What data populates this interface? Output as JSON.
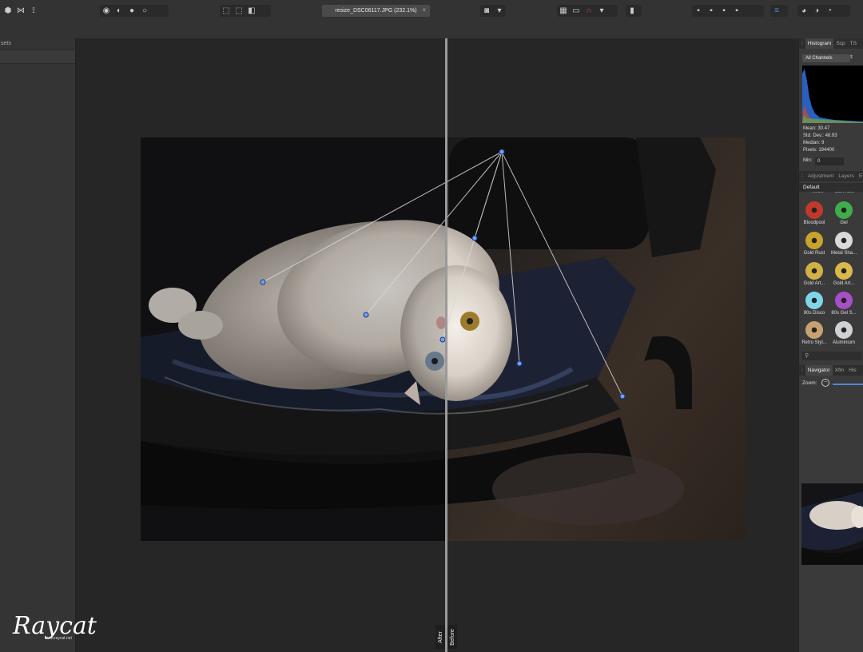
{
  "document": {
    "tab_title": "resize_DSC06117.JPG (232.1%)",
    "close_glyph": "×"
  },
  "left_panel": {
    "tab_label": "sets"
  },
  "compare": {
    "after_label": "After",
    "before_label": "Before"
  },
  "right_panel": {
    "top_tabs": [
      "Histogram",
      "Scp",
      "TS"
    ],
    "channel_select": "All Channels",
    "stats": {
      "mean": "Mean: 30.47",
      "std_dev": "Std. Dev.: 48.93",
      "median": "Median: 9",
      "pixels": "Pixels: 194400"
    },
    "min_label": "Min:",
    "min_value": "0",
    "mid_tabs": [
      "Adjustment",
      "Layers",
      "Ef"
    ],
    "preset_category": "Default",
    "cutoff_row": [
      "Neon",
      "Dark Glo"
    ],
    "presets": [
      {
        "label": "Bloodpool",
        "color": "#c0392b"
      },
      {
        "label": "Gel",
        "color": "#3fae49"
      },
      {
        "label": "Gold Rust",
        "color": "#c9a42c"
      },
      {
        "label": "Metal Sha...",
        "color": "#d9d9d9"
      },
      {
        "label": "Gold Art...",
        "color": "#d1b046"
      },
      {
        "label": "Gold Art...",
        "color": "#dbb84a"
      },
      {
        "label": "80s Disco",
        "color": "#7fd6e8"
      },
      {
        "label": "80s Gel S...",
        "color": "#a64fc6"
      },
      {
        "label": "Retro Styl...",
        "color": "#c7a271"
      },
      {
        "label": "Aluminium",
        "color": "#cfd2d4"
      }
    ],
    "bottom_tabs": [
      "Navigator",
      "Xfm",
      "His"
    ],
    "zoom_label": "Zoom:"
  },
  "watermark": {
    "text": "Raycat",
    "sub": "www.raycat.net"
  },
  "colors": {
    "accent": "#4a8ad6",
    "panel": "#3a3a3a",
    "canvas": "#262626"
  }
}
